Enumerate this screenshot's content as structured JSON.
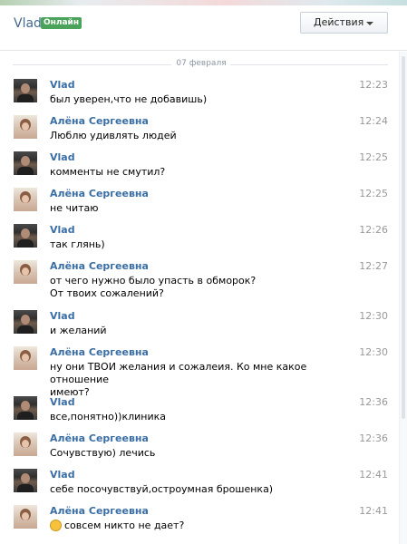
{
  "header": {
    "partner_name": "Vlad",
    "status_badge": "Онлайн",
    "actions_label": "Действия"
  },
  "date_separator": "07 февраля",
  "messages": [
    {
      "author": "Vlad",
      "time": "12:23",
      "text": "был уверен,что не добавишь)"
    },
    {
      "author": "Алёна Сергеевна",
      "time": "12:24",
      "text": "Люблю удивлять людей"
    },
    {
      "author": "Vlad",
      "time": "12:25",
      "text": "комменты не смутил?"
    },
    {
      "author": "Алёна Сергеевна",
      "time": "12:25",
      "text": "не читаю"
    },
    {
      "author": "Vlad",
      "time": "12:26",
      "text": "так глянь)"
    },
    {
      "author": "Алёна Сергеевна",
      "time": "12:27",
      "text": "от чего нужно было упасть в обморок?\nОт твоих сожалений?"
    },
    {
      "author": "Vlad",
      "time": "12:30",
      "text": "и желаний"
    },
    {
      "author": "Алёна Сергеевна",
      "time": "12:30",
      "text": "ну они ТВОИ желания и сожалеия. Ко мне какое отношение\nимеют?"
    },
    {
      "author": "Vlad",
      "time": "12:36",
      "text": "все,понятно))клиника"
    },
    {
      "author": "Алёна Сергеевна",
      "time": "12:36",
      "text": "Сочувствую) лечись"
    },
    {
      "author": "Vlad",
      "time": "12:41",
      "text": "себе посочувствуй,остроумная брошенка)"
    },
    {
      "author": "Алёна Сергеевна",
      "time": "12:41",
      "text": "совсем никто не дает?",
      "emoji": "smile-icon"
    }
  ]
}
